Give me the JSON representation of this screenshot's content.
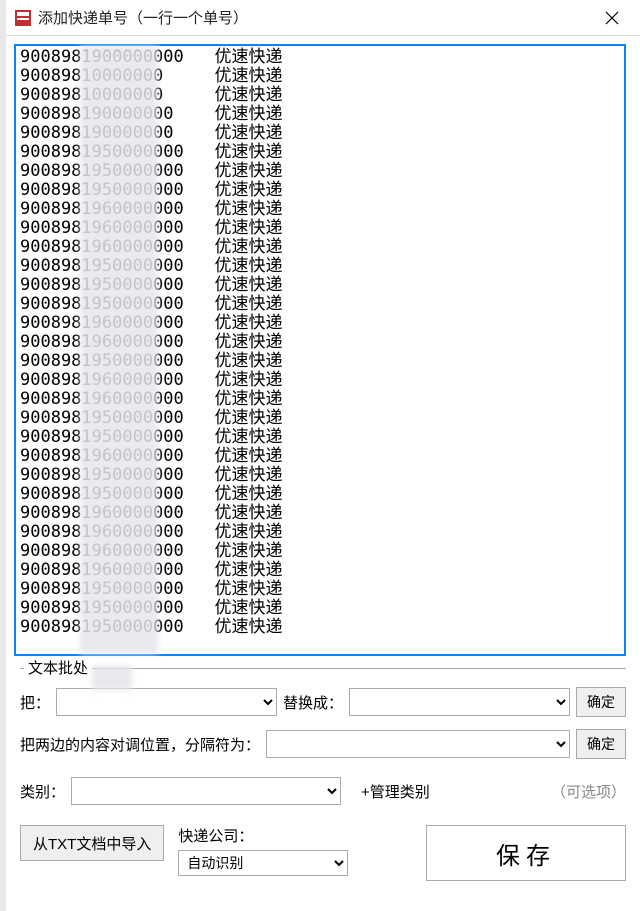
{
  "titlebar": {
    "title": "添加快递单号（一行一个单号）"
  },
  "tracking_lines": [
    "9008981900000000   优速快递",
    "90089810000000     优速快递",
    "90089810000000     优速快递",
    "900898190000000    优速快递",
    "900898190000000    优速快递",
    "9008981950000000   优速快递",
    "9008981950000000   优速快递",
    "9008981950000000   优速快递",
    "9008981960000000   优速快递",
    "9008981960000000   优速快递",
    "9008981960000000   优速快递",
    "9008981950000000   优速快递",
    "9008981950000000   优速快递",
    "9008981950000000   优速快递",
    "9008981960000000   优速快递",
    "9008981960000000   优速快递",
    "9008981950000000   优速快递",
    "9008981960000000   优速快递",
    "9008981960000000   优速快递",
    "9008981950000000   优速快递",
    "9008981950000000   优速快递",
    "9008981960000000   优速快递",
    "9008981950000000   优速快递",
    "9008981950000000   优速快递",
    "9008981960000000   优速快递",
    "9008981960000000   优速快递",
    "9008981960000000   优速快递",
    "9008981960000000   优速快递",
    "9008981950000000   优速快递",
    "9008981950000000   优速快递",
    "9008981950000000   优速快递"
  ],
  "section": {
    "label": "文本批处"
  },
  "replace": {
    "from_label": "把：",
    "to_label": "替换成：",
    "confirm": "确定"
  },
  "swap": {
    "label": "把两边的内容对调位置，分隔符为：",
    "confirm": "确定"
  },
  "category": {
    "label": "类别：",
    "manage": "+管理类别",
    "optional": "（可选项）"
  },
  "import_btn": "从TXT文档中导入",
  "courier": {
    "label": "快递公司：",
    "selected": "自动识别"
  },
  "save_btn": "保存"
}
